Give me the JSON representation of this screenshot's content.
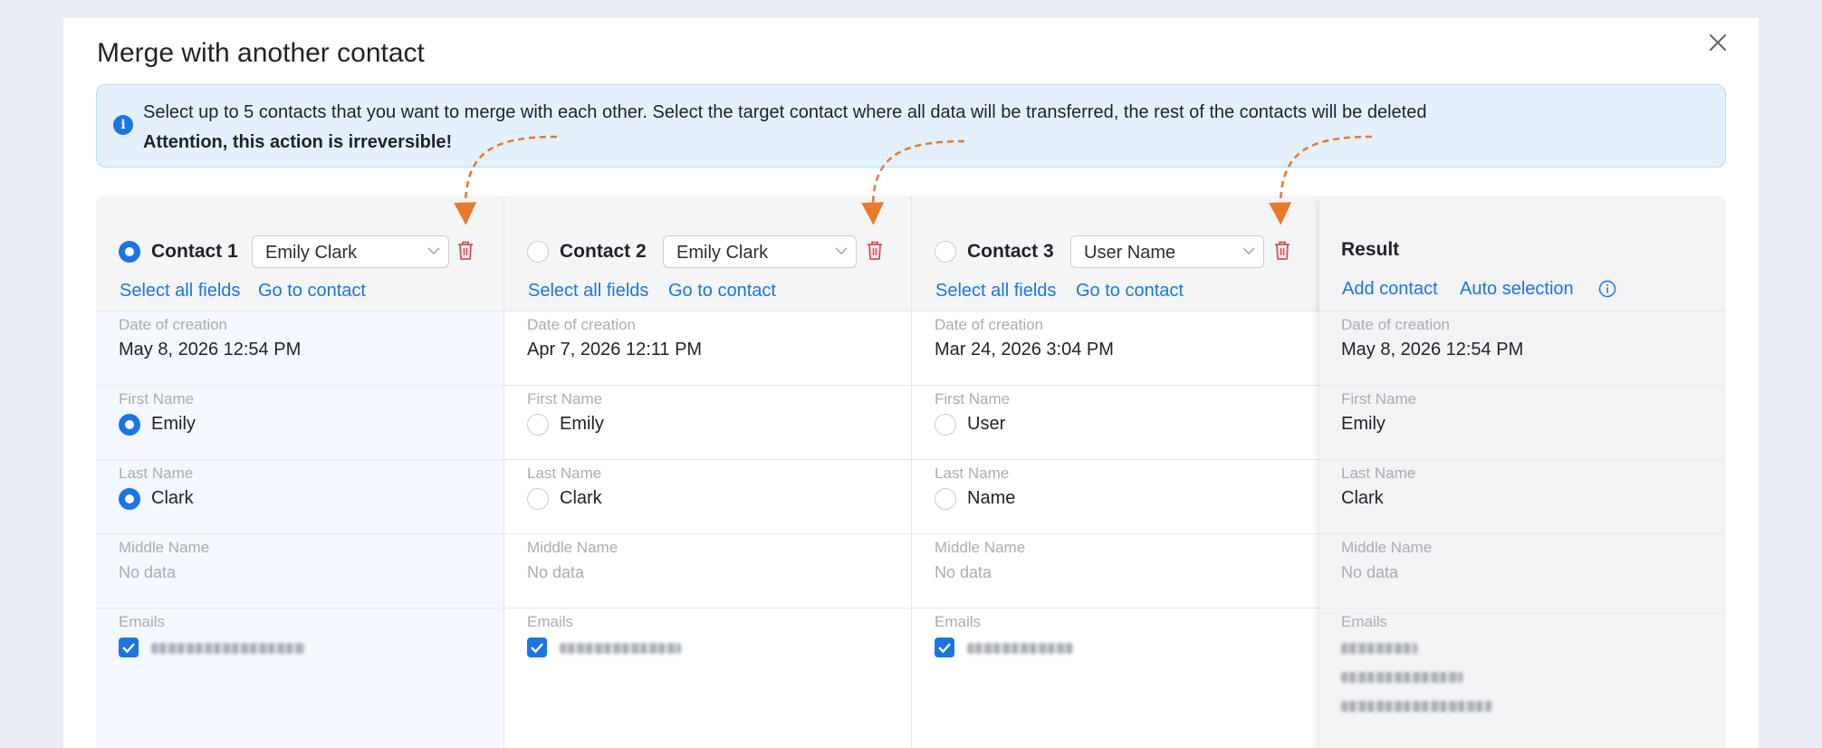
{
  "dialog": {
    "title": "Merge with another contact",
    "info_line1": "Select up to 5 contacts that you want to merge with each other. Select the target contact where all data will be transferred, the rest of the contacts will be deleted",
    "info_line2": "Attention, this action is irreversible!"
  },
  "colors": {
    "accent": "#1b75e6",
    "delete": "#e5484d",
    "annotation_arrow": "#e8782a"
  },
  "field_labels": {
    "date": "Date of creation",
    "first": "First Name",
    "last": "Last Name",
    "middle": "Middle Name",
    "emails": "Emails"
  },
  "contacts": [
    {
      "label": "Contact 1",
      "selected": true,
      "select_value": "Emily Clark",
      "select_all": "Select all fields",
      "go_to": "Go to contact",
      "date": "May 8, 2026 12:54 PM",
      "first": "Emily",
      "first_selected": true,
      "last": "Clark",
      "last_selected": true,
      "middle": "No data",
      "email_checked": true
    },
    {
      "label": "Contact 2",
      "selected": false,
      "select_value": "Emily Clark",
      "select_all": "Select all fields",
      "go_to": "Go to contact",
      "date": "Apr 7, 2026 12:11 PM",
      "first": "Emily",
      "first_selected": false,
      "last": "Clark",
      "last_selected": false,
      "middle": "No data",
      "email_checked": true
    },
    {
      "label": "Contact 3",
      "selected": false,
      "select_value": "User Name",
      "select_all": "Select all fields",
      "go_to": "Go to contact",
      "date": "Mar 24, 2026 3:04 PM",
      "first": "User",
      "first_selected": false,
      "last": "Name",
      "last_selected": false,
      "middle": "No data",
      "email_checked": true
    }
  ],
  "result": {
    "title": "Result",
    "add_contact": "Add contact",
    "auto_selection": "Auto selection",
    "date": "May 8, 2026 12:54 PM",
    "first": "Emily",
    "last": "Clark",
    "middle": "No data"
  }
}
